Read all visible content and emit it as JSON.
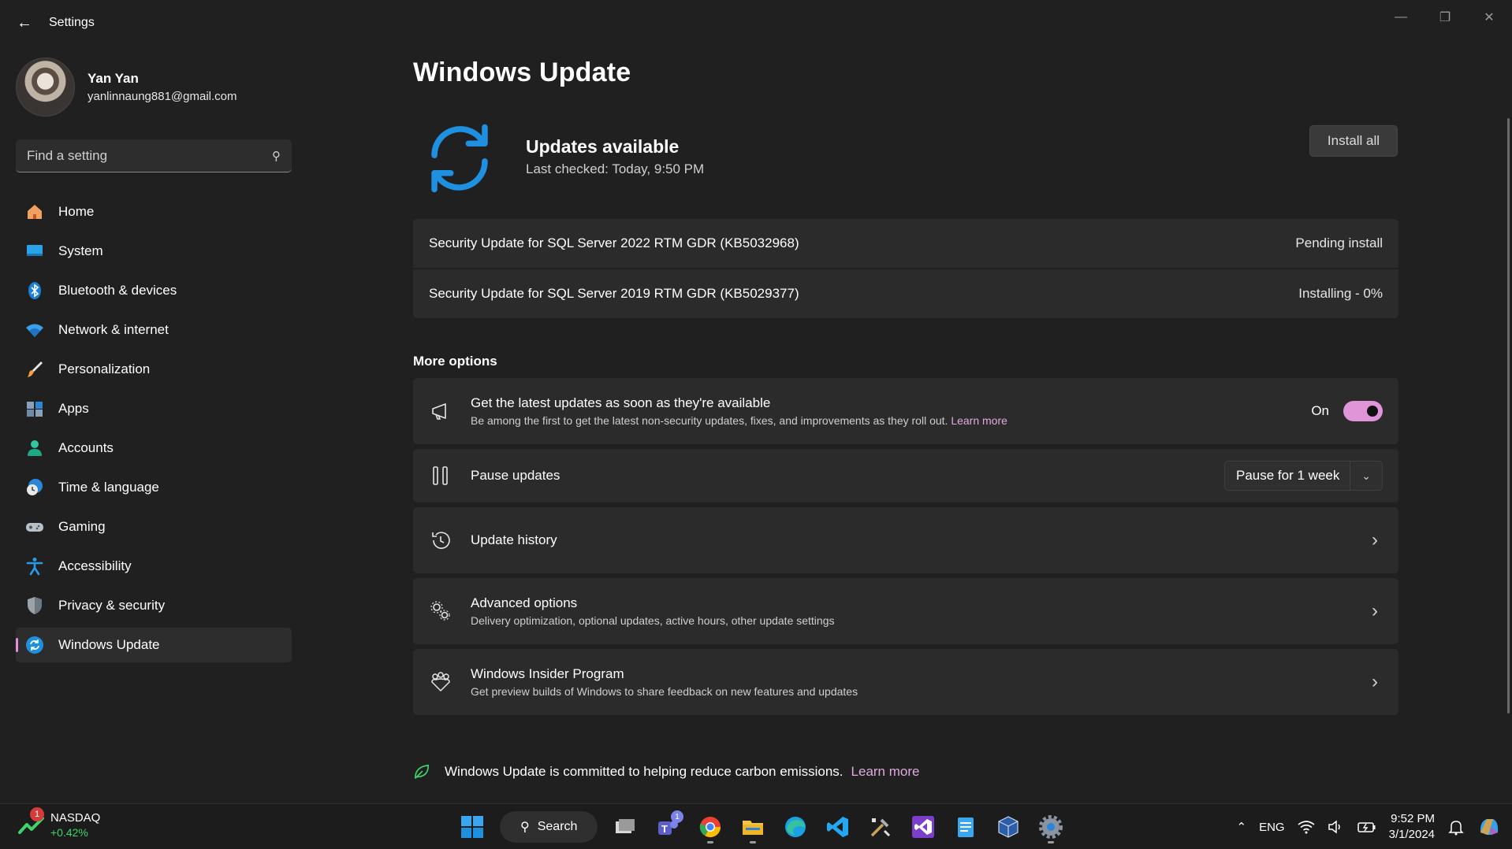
{
  "window": {
    "title": "Settings"
  },
  "profile": {
    "name": "Yan Yan",
    "email": "yanlinnaung881@gmail.com"
  },
  "search": {
    "placeholder": "Find a setting"
  },
  "nav": [
    {
      "label": "Home",
      "icon": "home-icon"
    },
    {
      "label": "System",
      "icon": "system-icon"
    },
    {
      "label": "Bluetooth & devices",
      "icon": "bluetooth-icon"
    },
    {
      "label": "Network & internet",
      "icon": "wifi-icon"
    },
    {
      "label": "Personalization",
      "icon": "brush-icon"
    },
    {
      "label": "Apps",
      "icon": "apps-icon"
    },
    {
      "label": "Accounts",
      "icon": "accounts-icon"
    },
    {
      "label": "Time & language",
      "icon": "time-language-icon"
    },
    {
      "label": "Gaming",
      "icon": "gamepad-icon"
    },
    {
      "label": "Accessibility",
      "icon": "accessibility-icon"
    },
    {
      "label": "Privacy & security",
      "icon": "shield-icon"
    },
    {
      "label": "Windows Update",
      "icon": "windows-update-icon",
      "active": true
    }
  ],
  "page": {
    "title": "Windows Update"
  },
  "status": {
    "title": "Updates available",
    "last_checked": "Last checked: Today, 9:50 PM",
    "install_label": "Install all"
  },
  "updates": [
    {
      "name": "Security Update for SQL Server 2022 RTM GDR (KB5032968)",
      "status": "Pending install"
    },
    {
      "name": "Security Update for SQL Server 2019 RTM GDR (KB5029377)",
      "status": "Installing - 0%"
    }
  ],
  "more_options": {
    "title": "More options",
    "latest": {
      "title": "Get the latest updates as soon as they're available",
      "desc": "Be among the first to get the latest non-security updates, fixes, and improvements as they roll out.",
      "link": "Learn more",
      "toggle_label": "On",
      "toggle_on": true
    },
    "pause": {
      "title": "Pause updates",
      "selected": "Pause for 1 week"
    },
    "history": {
      "title": "Update history"
    },
    "advanced": {
      "title": "Advanced options",
      "desc": "Delivery optimization, optional updates, active hours, other update settings"
    },
    "insider": {
      "title": "Windows Insider Program",
      "desc": "Get preview builds of Windows to share feedback on new features and updates"
    }
  },
  "footer": {
    "text": "Windows Update is committed to helping reduce carbon emissions.",
    "link": "Learn more"
  },
  "taskbar": {
    "widget_name": "NASDAQ",
    "widget_value": "+0.42%",
    "widget_badge": "1",
    "search_label": "Search",
    "teams_badge": "1",
    "lang": "ENG",
    "time": "9:52 PM",
    "date": "3/1/2024"
  },
  "colors": {
    "accent": "#e095d8",
    "link": "#e0a9e0",
    "update_blue": "#1f8fe0",
    "stock_green": "#3fd36a"
  }
}
